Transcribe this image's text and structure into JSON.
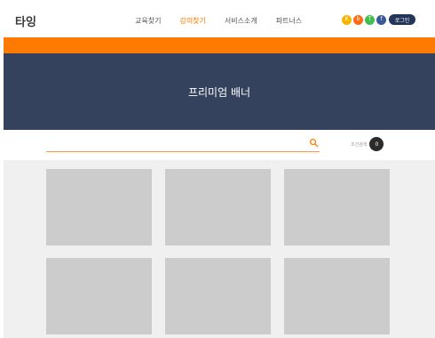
{
  "header": {
    "logo": "타잉",
    "nav": [
      {
        "label": "교육찾기",
        "active": false
      },
      {
        "label": "강의찾기",
        "active": true
      },
      {
        "label": "서비스소개",
        "active": false
      },
      {
        "label": "파트너스",
        "active": false
      }
    ],
    "social": [
      {
        "icon": "kakao-icon",
        "glyph": "K",
        "color": "#f7b500"
      },
      {
        "icon": "blog-icon",
        "glyph": "b",
        "color": "#ff6a13"
      },
      {
        "icon": "talk-icon",
        "glyph": "T",
        "color": "#3fbd4d"
      },
      {
        "icon": "facebook-icon",
        "glyph": "f",
        "color": "#3b5998"
      }
    ],
    "login_label": "로그인"
  },
  "banner": {
    "title": "프리미엄 배너"
  },
  "search": {
    "placeholder": "",
    "filter_label": "조건검색",
    "filter_count": "0"
  },
  "cards": [
    {},
    {},
    {},
    {},
    {},
    {}
  ],
  "colors": {
    "accent": "#ff7a00",
    "banner": "#34425e",
    "login": "#233559",
    "card": "#cccccc"
  }
}
